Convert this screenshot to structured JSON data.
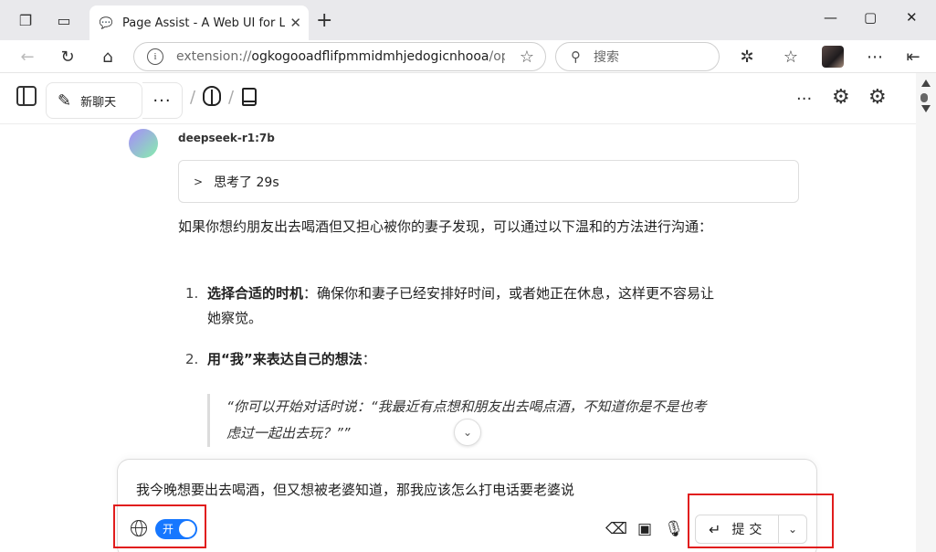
{
  "browser": {
    "tab_title": "Page Assist - A Web UI for Local AI Model",
    "url_prefix": "extension://",
    "url_host": "ogkogooadflifpmmidmhjedogicnhooa",
    "url_rest": "/options.html#/",
    "search_placeholder": "搜索"
  },
  "header": {
    "new_chat_label": "新聊天"
  },
  "message": {
    "model_name": "deepseek-r1:7b",
    "thinking_label": "思考了 29s",
    "intro": "如果你想约朋友出去喝酒但又担心被你的妻子发现，可以通过以下温和的方法进行沟通：",
    "items": [
      {
        "number": "1.",
        "bold": "选择合适的时机",
        "text": "：确保你和妻子已经安排好时间，或者她正在休息，这样更不容易让她察觉。"
      },
      {
        "number": "2.",
        "bold": "用“我”来表达自己的想法",
        "text": "："
      }
    ],
    "quote": "“你可以开始对话时说：“我最近有点想和朋友出去喝点酒，不知道你是不是也考虑过一起出去玩？””"
  },
  "composer": {
    "input_text": "我今晚想要出去喝酒，但又想被老婆知道，那我应该怎么打电话要老婆说",
    "toggle_label": "开",
    "submit_label": "提交"
  },
  "colors": {
    "accent": "#1677ff",
    "highlight": "#e11d1d"
  }
}
